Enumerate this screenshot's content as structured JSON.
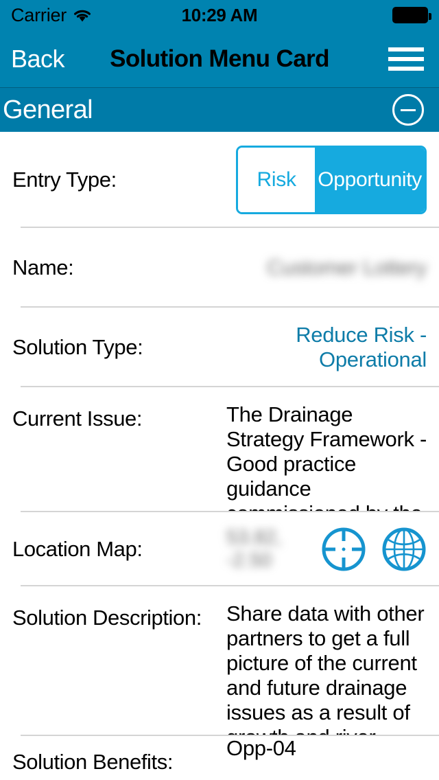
{
  "status_bar": {
    "carrier": "Carrier",
    "time": "10:29 AM",
    "wifi_icon": "wifi-icon",
    "battery_icon": "battery-full-icon"
  },
  "nav_bar": {
    "back_label": "Back",
    "title": "Solution Menu Card",
    "menu_icon": "hamburger-menu-icon"
  },
  "section": {
    "title": "General",
    "collapse_icon": "minus-circle-icon"
  },
  "colors": {
    "nav_background": "#0083B0",
    "section_background": "#007BA8",
    "accent": "#16AADF",
    "link": "#0E7CA8",
    "separator": "#d4d4d4",
    "text": "#000000"
  },
  "form": {
    "entry_type": {
      "label": "Entry Type:",
      "options": [
        "Risk",
        "Opportunity"
      ],
      "selected": "Opportunity"
    },
    "name": {
      "label": "Name:",
      "value": "Customer Lottery",
      "redacted": true
    },
    "solution_type": {
      "label": "Solution Type:",
      "value": "Reduce Risk - Operational"
    },
    "current_issue": {
      "label": "Current Issue:",
      "value": "The Drainage Strategy Framework - Good practice guidance commissioned by the Environment Agency and Ofwat highlights the importance"
    },
    "location_map": {
      "label": "Location Map:",
      "value": "53.82, -2.50",
      "redacted": true,
      "locate_icon": "crosshair-target-icon",
      "globe_icon": "globe-icon"
    },
    "solution_description": {
      "label": "Solution Description:",
      "value": "Share data with other partners to get a full picture of the current and future drainage issues as a result of growth and river flooding. YW have"
    },
    "solution_benefits": {
      "label": "Solution Benefits:",
      "value": "Opp-04"
    }
  }
}
